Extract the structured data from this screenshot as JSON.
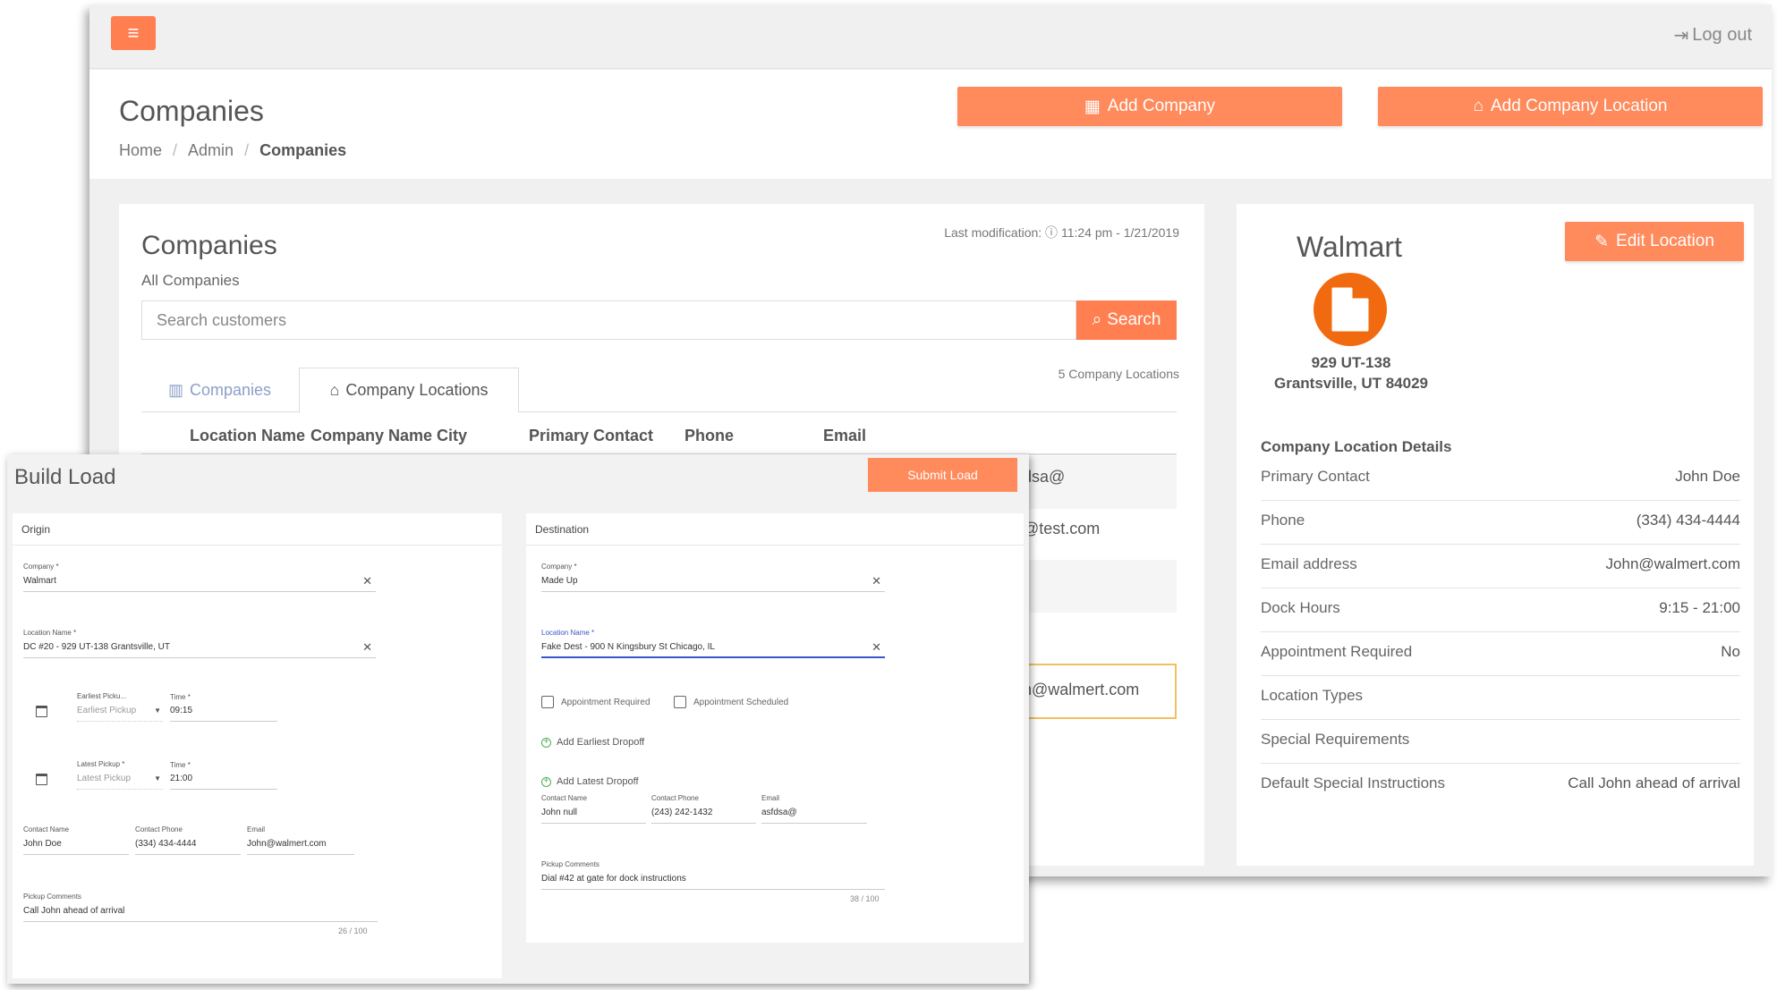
{
  "topbar": {
    "logout_label": "Log out"
  },
  "header": {
    "title": "Companies",
    "breadcrumb": [
      "Home",
      "Admin",
      "Companies"
    ],
    "add_company_label": "Add Company",
    "add_location_label": "Add Company Location"
  },
  "companies": {
    "title": "Companies",
    "subtitle": "All Companies",
    "last_modification": "Last modification: ⓘ 11:24 pm - 1/21/2019",
    "search_placeholder": "Search customers",
    "search_label": "Search",
    "tabs": [
      "Companies",
      "Company Locations"
    ],
    "location_count": "5 Company Locations",
    "columns": [
      "Location Name",
      "Company Name",
      "City",
      "Primary Contact",
      "Phone",
      "Email"
    ],
    "visible_email_fragments": [
      "dsa@",
      "@test.com",
      "n@walmert.com"
    ]
  },
  "location": {
    "name": "Walmart",
    "edit_label": "Edit Location",
    "address_line1": "929 UT-138",
    "address_line2": "Grantsville, UT 84029",
    "details_title": "Company Location Details",
    "details": [
      {
        "label": "Primary Contact",
        "value": "John Doe"
      },
      {
        "label": "Phone",
        "value": "(334) 434-4444"
      },
      {
        "label": "Email address",
        "value": "John@walmert.com"
      },
      {
        "label": "Dock Hours",
        "value": "9:15 - 21:00"
      },
      {
        "label": "Appointment Required",
        "value": "No"
      },
      {
        "label": "Location Types",
        "value": ""
      },
      {
        "label": "Special Requirements",
        "value": ""
      },
      {
        "label": "Default Special Instructions",
        "value": "Call John ahead of arrival"
      }
    ]
  },
  "build_load": {
    "title": "Build Load",
    "submit_label": "Submit Load",
    "origin": {
      "heading": "Origin",
      "company_label": "Company *",
      "company_value": "Walmart",
      "location_label": "Location Name *",
      "location_value": "DC #20 - 929 UT-138 Grantsville, UT",
      "earliest_label": "Earliest Picku...",
      "earliest_placeholder": "Earliest Pickup",
      "earliest_time_label": "Time *",
      "earliest_time": "09:15",
      "latest_label": "Latest Pickup *",
      "latest_placeholder": "Latest Pickup",
      "latest_time_label": "Time *",
      "latest_time": "21:00",
      "contact_name_label": "Contact Name",
      "contact_name": "John Doe",
      "contact_phone_label": "Contact Phone",
      "contact_phone": "(334) 434-4444",
      "email_label": "Email",
      "email": "John@walmert.com",
      "comments_label": "Pickup Comments",
      "comments": "Call John ahead of arrival",
      "counter": "26 / 100"
    },
    "destination": {
      "heading": "Destination",
      "company_label": "Company *",
      "company_value": "Made Up",
      "location_label": "Location Name *",
      "location_value": "Fake Dest - 900 N Kingsbury St Chicago, IL",
      "appt_required": "Appointment Required",
      "appt_scheduled": "Appointment Scheduled",
      "add_earliest": "Add Earliest Dropoff",
      "add_latest": "Add Latest Dropoff",
      "contact_name_label": "Contact Name",
      "contact_name": "John null",
      "contact_phone_label": "Contact Phone",
      "contact_phone": "(243) 242-1432",
      "email_label": "Email",
      "email": "asfdsa@",
      "comments_label": "Pickup Comments",
      "comments": "Dial #42 at gate for dock instructions",
      "counter": "38 / 100"
    }
  },
  "colors": {
    "accent": "#ff7f50",
    "walmart_logo": "#f26a10",
    "focus": "#3a56c8"
  }
}
